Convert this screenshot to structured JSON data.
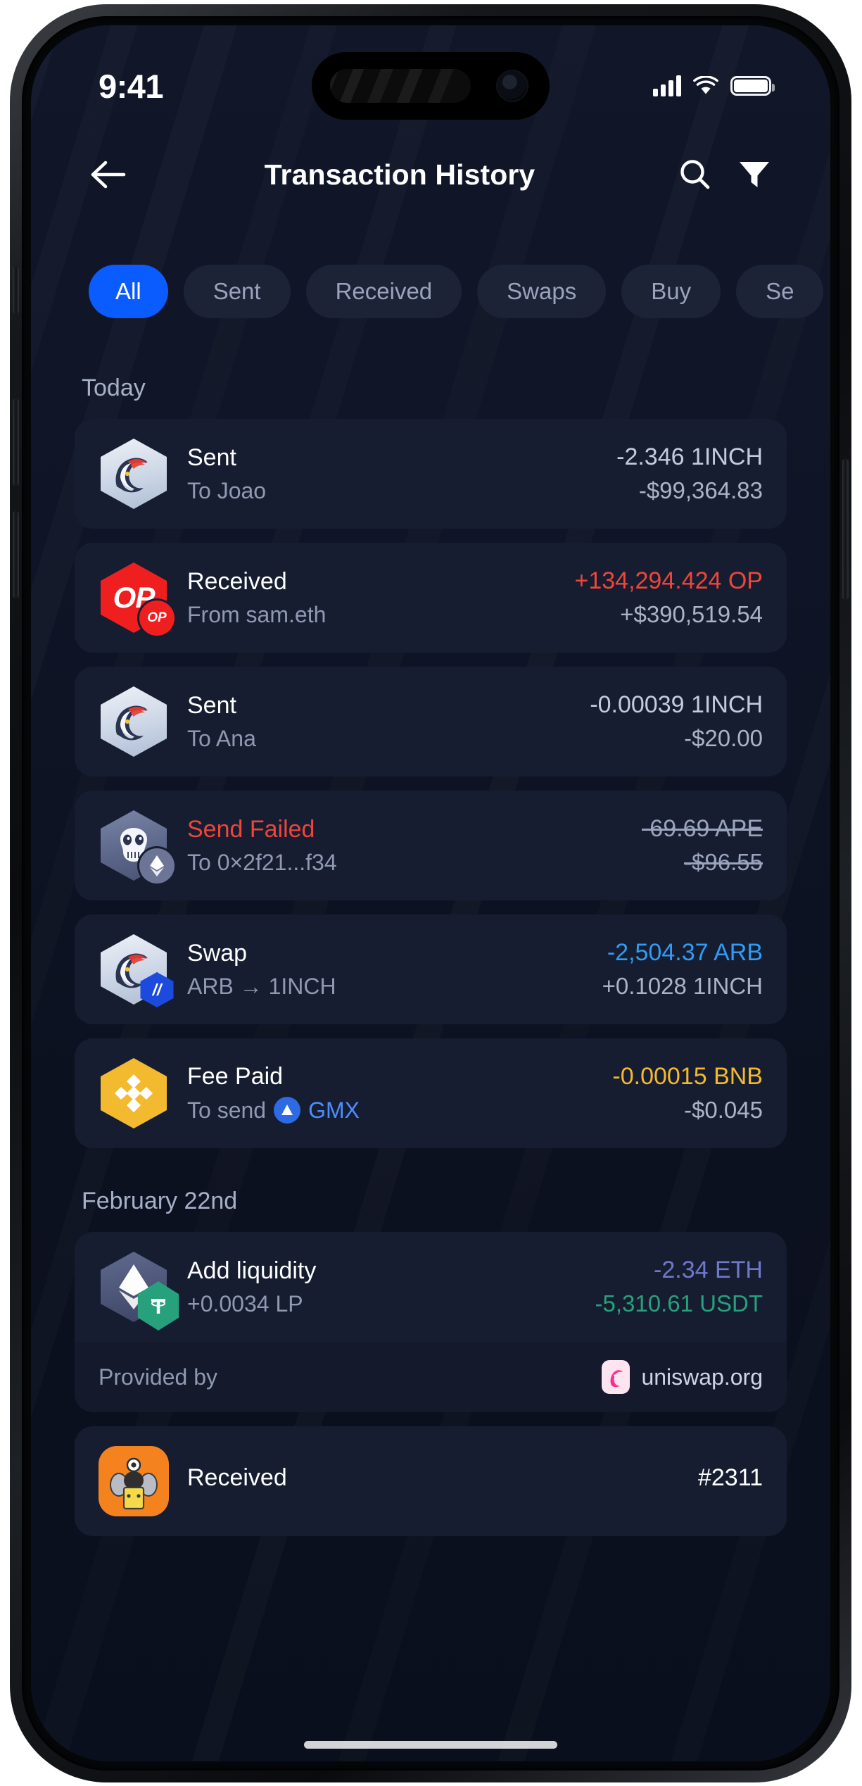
{
  "status_bar": {
    "time": "9:41",
    "signal_icon": "cellular-signal-icon",
    "wifi_icon": "wifi-icon",
    "battery_icon": "battery-icon"
  },
  "header": {
    "back_icon": "back-arrow-icon",
    "title": "Transaction History",
    "search_icon": "search-icon",
    "filter_icon": "filter-funnel-icon"
  },
  "filters": {
    "active": "All",
    "chips": [
      {
        "label": "All",
        "active": true
      },
      {
        "label": "Sent",
        "active": false
      },
      {
        "label": "Received",
        "active": false
      },
      {
        "label": "Swaps",
        "active": false
      },
      {
        "label": "Buy",
        "active": false
      },
      {
        "label": "Se",
        "active": false
      }
    ]
  },
  "colors": {
    "accent_blue": "#0b5cff",
    "screen_bg": "#0f1526",
    "card_bg": "#161d31",
    "text_primary": "#ffffff",
    "text_secondary": "#8f99b2",
    "red": "#f0453a",
    "blue_amount": "#2f9cf5",
    "yellow": "#f3ba2f",
    "green": "#26a17b",
    "purple": "#6f79c9",
    "link": "#4d8dfb"
  },
  "sections": [
    {
      "header": "Today",
      "transactions": [
        {
          "icon": "1inch-token-icon",
          "badge": null,
          "title": "Sent",
          "title_color": "#ffffff",
          "subtitle": "To Joao",
          "subtitle_chain_icon": null,
          "amount": "-2.346 1INCH",
          "amount_color": "#c3cbdd",
          "fiat": "-$99,364.83",
          "fiat_color": "#aab3c8",
          "strikethrough": false
        },
        {
          "icon": "optimism-token-icon",
          "badge": "optimism-chain-badge",
          "title": "Received",
          "title_color": "#ffffff",
          "subtitle": "From sam.eth",
          "subtitle_chain_icon": null,
          "amount": "+134,294.424 OP",
          "amount_color": "#f0453a",
          "fiat": "+$390,519.54",
          "fiat_color": "#aab3c8",
          "strikethrough": false
        },
        {
          "icon": "1inch-token-icon",
          "badge": null,
          "title": "Sent",
          "title_color": "#ffffff",
          "subtitle": "To Ana",
          "subtitle_chain_icon": null,
          "amount": "-0.00039 1INCH",
          "amount_color": "#c3cbdd",
          "fiat": "-$20.00",
          "fiat_color": "#aab3c8",
          "strikethrough": false
        },
        {
          "icon": "apecoin-token-icon",
          "badge": "ethereum-chain-badge",
          "title": "Send Failed",
          "title_color": "#f0453a",
          "subtitle": "To 0×2f21...f34",
          "subtitle_chain_icon": null,
          "amount": "-69.69 APE",
          "amount_color": "#9aa4bd",
          "fiat": "-$96.55",
          "fiat_color": "#9aa4bd",
          "strikethrough": true
        },
        {
          "icon": "1inch-token-icon",
          "badge": "arbitrum-chain-badge",
          "title": "Swap",
          "title_color": "#ffffff",
          "subtitle": "ARB → 1INCH",
          "subtitle_chain_icon": null,
          "amount": "-2,504.37 ARB",
          "amount_color": "#2f9cf5",
          "fiat": "+0.1028 1INCH",
          "fiat_color": "#aab3c8",
          "strikethrough": false
        },
        {
          "icon": "bnb-token-icon",
          "badge": null,
          "title": "Fee Paid",
          "title_color": "#ffffff",
          "subtitle": "To send",
          "subtitle_chain_icon": "gmx-token-icon",
          "subtitle_link": "GMX",
          "amount": "-0.00015 BNB",
          "amount_color": "#f3ba2f",
          "fiat": "-$0.045",
          "fiat_color": "#aab3c8",
          "strikethrough": false
        }
      ]
    },
    {
      "header": "February 22nd",
      "transactions": [
        {
          "icon": "ethereum-token-icon",
          "badge": "tether-token-badge",
          "title": "Add liquidity",
          "title_color": "#ffffff",
          "subtitle": "+0.0034 LP",
          "subtitle_chain_icon": null,
          "amount": "-2.34 ETH",
          "amount_color": "#6f79c9",
          "fiat": "-5,310.61 USDT",
          "fiat_color": "#26a17b",
          "strikethrough": false,
          "footer": {
            "label": "Provided by",
            "logo_icon": "uniswap-logo-icon",
            "link": "uniswap.org"
          }
        },
        {
          "icon": "nft-collectible-icon",
          "badge": null,
          "title": "Received",
          "title_color": "#ffffff",
          "subtitle": "",
          "subtitle_chain_icon": null,
          "amount": "#2311",
          "amount_color": "#ffffff",
          "fiat": "",
          "fiat_color": "#aab3c8",
          "strikethrough": false,
          "partial": true
        }
      ]
    }
  ]
}
